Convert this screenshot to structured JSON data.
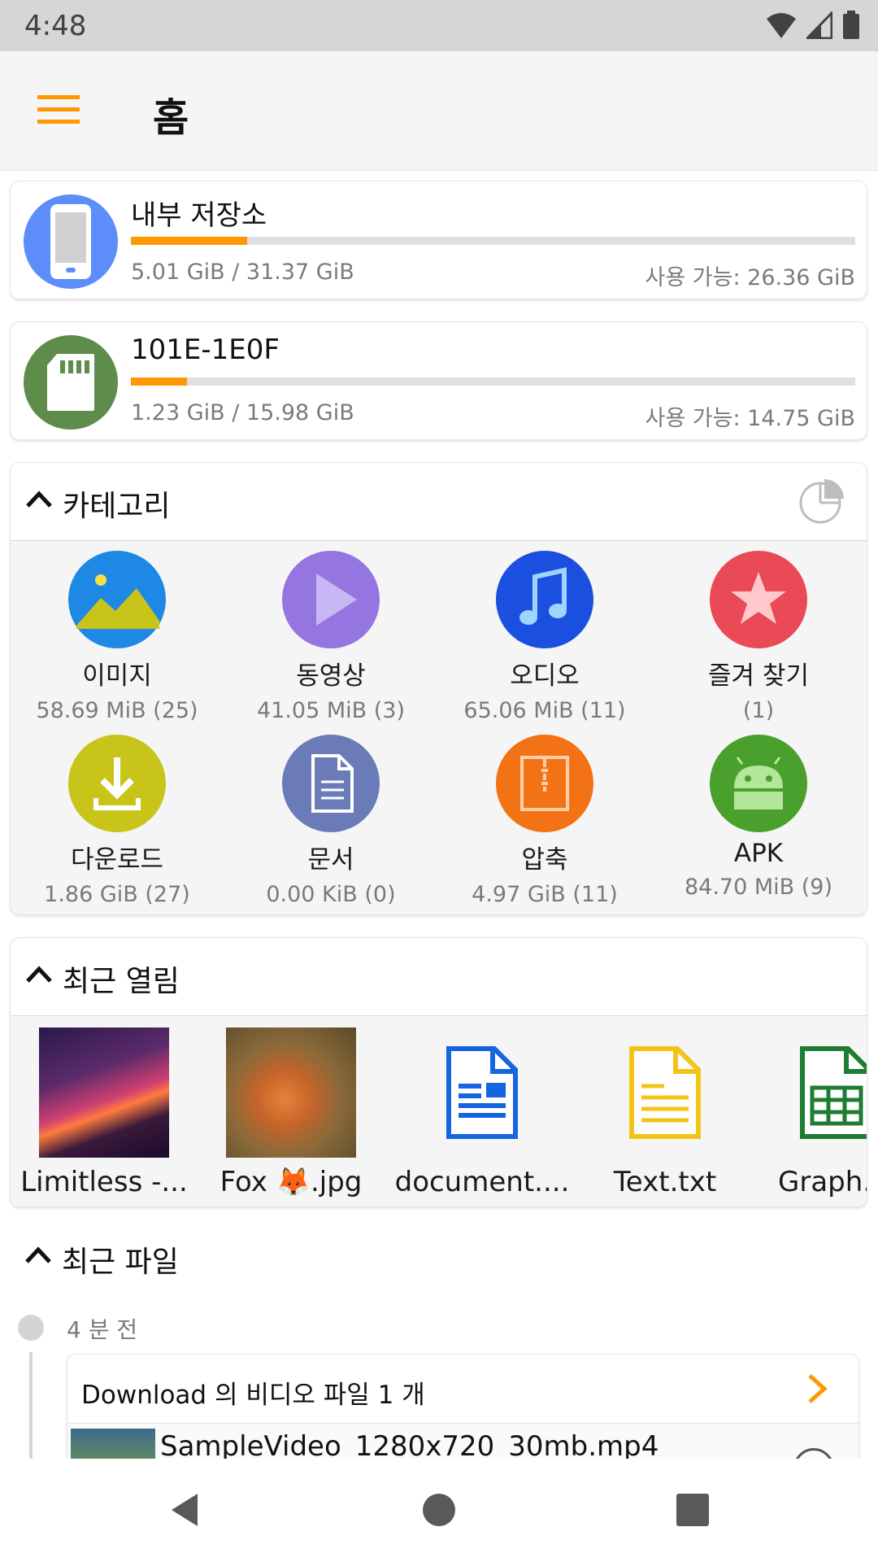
{
  "status_bar": {
    "time": "4:48",
    "icons": [
      "wifi-icon",
      "cell-signal-icon",
      "battery-icon"
    ]
  },
  "app_bar": {
    "menu_icon": "hamburger-menu-icon",
    "title": "홈"
  },
  "storage": [
    {
      "name": "내부 저장소",
      "icon": "phone-icon",
      "icon_color": "#5c8dfa",
      "used_text": "5.01 GiB / 31.37 GiB",
      "free_text": "사용 가능: 26.36 GiB",
      "used_fraction": 0.16
    },
    {
      "name": "101E-1E0F",
      "icon": "sd-card-icon",
      "icon_color": "#5e8c4a",
      "used_text": "1.23 GiB / 15.98 GiB",
      "free_text": "사용 가능: 14.75 GiB",
      "used_fraction": 0.077
    }
  ],
  "categories": {
    "title": "카테고리",
    "chart_icon": "pie-chart-icon",
    "items": [
      {
        "label": "이미지",
        "size": "58.69 MiB (25)",
        "icon": "image-icon",
        "color": "#1e88e5"
      },
      {
        "label": "동영상",
        "size": "41.05 MiB (3)",
        "icon": "play-icon",
        "color": "#9575e0"
      },
      {
        "label": "오디오",
        "size": "65.06 MiB (11)",
        "icon": "music-note-icon",
        "color": "#1a4fe0"
      },
      {
        "label": "즐겨 찾기",
        "size": "(1)",
        "icon": "star-icon",
        "color": "#e94a55"
      },
      {
        "label": "다운로드",
        "size": "1.86 GiB (27)",
        "icon": "download-icon",
        "color": "#c9c41a"
      },
      {
        "label": "문서",
        "size": "0.00 KiB (0)",
        "icon": "document-icon",
        "color": "#6a7bb8"
      },
      {
        "label": "압축",
        "size": "4.97 GiB (11)",
        "icon": "archive-icon",
        "color": "#f47216"
      },
      {
        "label": "APK",
        "size": "84.70 MiB (9)",
        "icon": "android-icon",
        "color": "#4aa02c"
      }
    ]
  },
  "recent_opened": {
    "title": "최근 열림",
    "items": [
      {
        "name": "Limitless -...",
        "icon": "album-art-thumbnail"
      },
      {
        "name": "Fox 🦊.jpg",
        "icon": "fox-photo-thumbnail"
      },
      {
        "name": "document....",
        "icon": "word-document-icon"
      },
      {
        "name": "Text.txt",
        "icon": "text-file-icon"
      },
      {
        "name": "Graph.x",
        "icon": "spreadsheet-icon"
      }
    ]
  },
  "recent_files": {
    "title": "최근 파일",
    "groups": [
      {
        "time": "4 분 전",
        "title": "Download 의 비디오 파일 1 개",
        "files": [
          {
            "name": "SampleVideo_1280x720_30mb.mp4"
          }
        ]
      }
    ]
  },
  "nav_bar": {
    "buttons": [
      "back-icon",
      "home-icon",
      "recents-icon"
    ]
  },
  "colors": {
    "accent": "#ff9800",
    "status_bar": "#d6d6d6",
    "app_bar": "#f5f5f5"
  }
}
